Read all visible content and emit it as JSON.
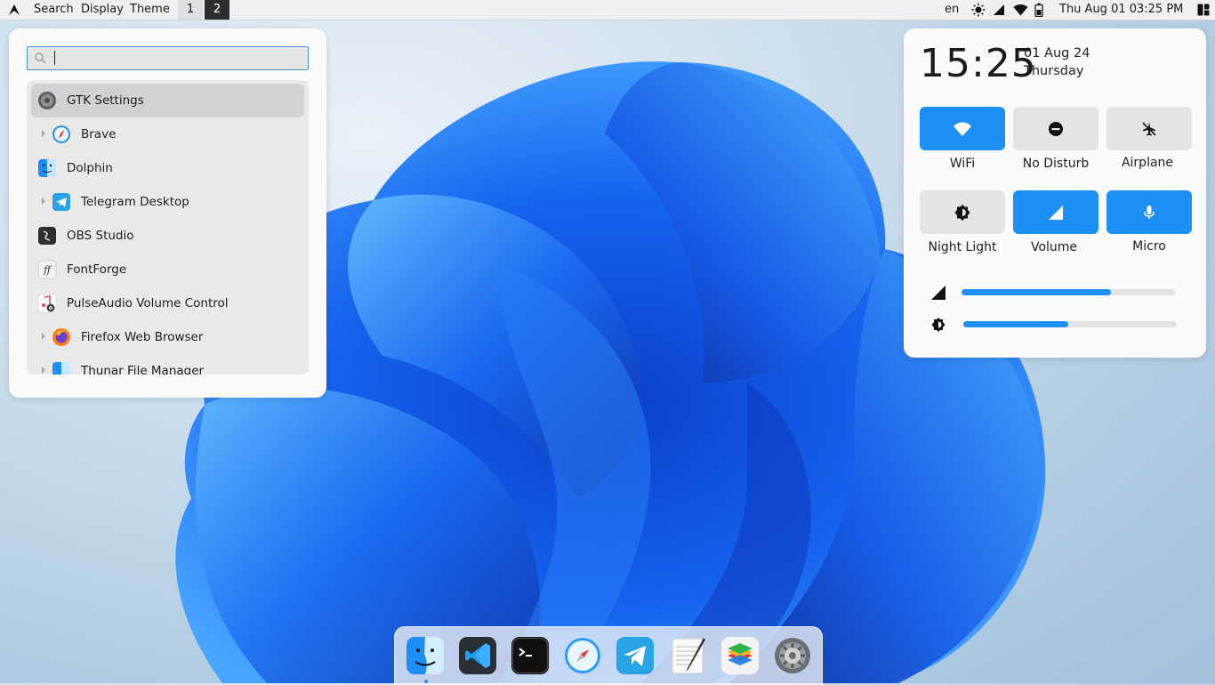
{
  "topbar": {
    "menus": [
      "Search",
      "Display",
      "Theme"
    ],
    "workspaces": [
      "1",
      "2"
    ],
    "active_workspace": "2",
    "keyboard_layout": "en",
    "datetime": "Thu Aug 01  03:25 PM",
    "tray_icons": [
      "brightness-icon",
      "signal-icon",
      "wifi-icon",
      "battery-icon",
      "notifications-icon"
    ]
  },
  "launcher": {
    "search_value": "",
    "apps": [
      {
        "label": "GTK Settings",
        "icon": "gear-icon",
        "expandable": false,
        "selected": true
      },
      {
        "label": "Brave",
        "icon": "brave-icon",
        "expandable": true,
        "selected": false
      },
      {
        "label": "Dolphin",
        "icon": "finder-icon",
        "expandable": false,
        "selected": false
      },
      {
        "label": "Telegram Desktop",
        "icon": "telegram-icon",
        "expandable": true,
        "selected": false
      },
      {
        "label": "OBS Studio",
        "icon": "obs-icon",
        "expandable": false,
        "selected": false
      },
      {
        "label": "FontForge",
        "icon": "fontforge-icon",
        "expandable": false,
        "selected": false
      },
      {
        "label": "PulseAudio Volume Control",
        "icon": "music-icon",
        "expandable": false,
        "selected": false
      },
      {
        "label": "Firefox Web Browser",
        "icon": "firefox-icon",
        "expandable": true,
        "selected": false
      },
      {
        "label": "Thunar File Manager",
        "icon": "finder-icon",
        "expandable": true,
        "selected": false
      }
    ]
  },
  "control_center": {
    "clock": "15:25",
    "date": "01 Aug 24",
    "day": "Thursday",
    "toggles": [
      {
        "label": "WiFi",
        "icon": "wifi-icon",
        "on": true
      },
      {
        "label": "No Disturb",
        "icon": "minus-circle-icon",
        "on": false
      },
      {
        "label": "Airplane",
        "icon": "airplane-off-icon",
        "on": false
      },
      {
        "label": "Night Light",
        "icon": "brightness-icon",
        "on": false
      },
      {
        "label": "Volume",
        "icon": "volume-icon",
        "on": true
      },
      {
        "label": "Micro",
        "icon": "microphone-icon",
        "on": true
      }
    ],
    "volume_level": 0.7,
    "brightness_level": 0.49
  },
  "dock": {
    "apps": [
      "Finder",
      "Visual Studio Code",
      "Terminal",
      "Safari",
      "Telegram",
      "TextEdit",
      "Stacks",
      "System Settings"
    ],
    "running_indicator": "Finder"
  },
  "colors": {
    "accent": "#1e90f5",
    "panel_bg": "#fafafa",
    "tile_off": "#e4e4e4",
    "topbar_bg": "#eef0f2"
  }
}
